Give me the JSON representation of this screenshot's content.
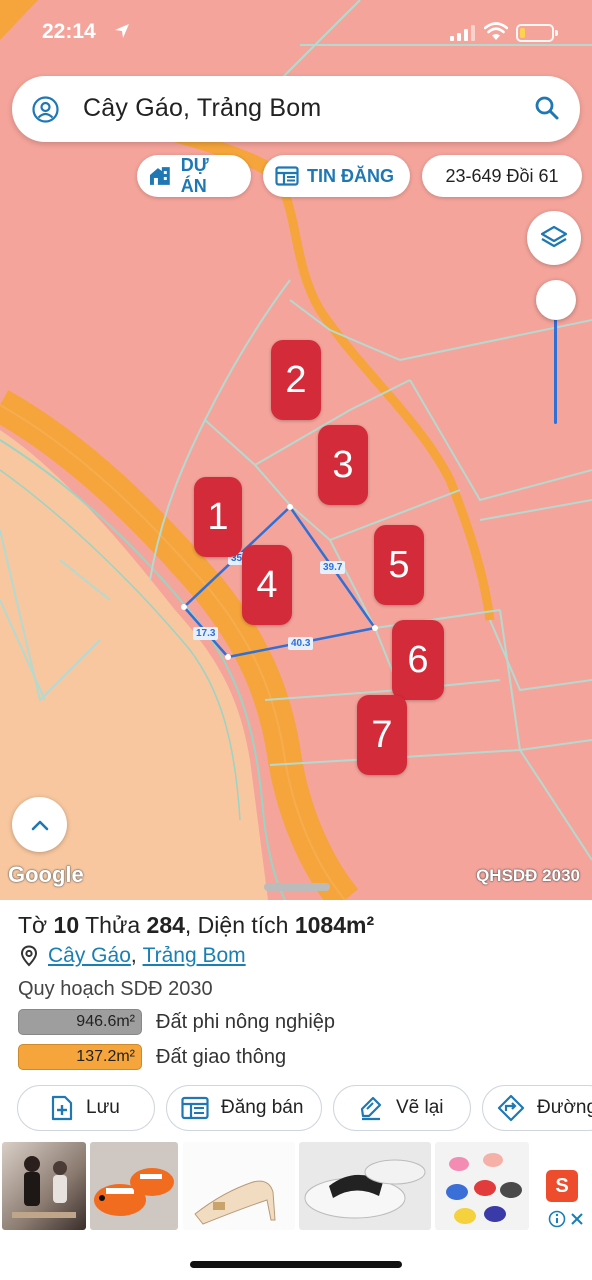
{
  "status_bar": {
    "time": "22:14"
  },
  "search": {
    "query": "Cây Gáo, Trảng Bom"
  },
  "chips": {
    "du_an": "DỰ ÁN",
    "tin_dang": "TIN ĐĂNG",
    "ref": "23-649 Đồi 61"
  },
  "map": {
    "markers": [
      "2",
      "3",
      "1",
      "4",
      "5",
      "6",
      "7"
    ],
    "dimensions": {
      "top_left": "35",
      "right": "39.7",
      "left": "17.3",
      "bottom": "40.3"
    },
    "watermark": "Google",
    "layer_label": "QHSDĐ 2030",
    "colors": {
      "land": "#f4a49b",
      "peach": "#f8c79f",
      "road": "#f5a53b",
      "parcel": "#2f6fd6",
      "marker": "#d42b3a"
    }
  },
  "parcel": {
    "title_prefix": "Tờ",
    "sheet": "10",
    "plot_prefix": "Thửa",
    "plot": "284",
    "area_text": ", Diện tích",
    "area": "1084m²",
    "commune": "Cây Gáo",
    "separator": ",",
    "district": "Trảng Bom",
    "plan_label": "Quy hoạch SDĐ 2030",
    "land_uses": [
      {
        "area": "946.6m²",
        "label": "Đất phi nông nghiệp",
        "color": "#9e9e9e"
      },
      {
        "area": "137.2m²",
        "label": "Đất giao thông",
        "color": "#f5a53b"
      }
    ]
  },
  "actions": {
    "save": "Lưu",
    "post": "Đăng bán",
    "redraw": "Vẽ lại",
    "route": "Đường"
  },
  "ads": {
    "shop_badge": "S"
  }
}
